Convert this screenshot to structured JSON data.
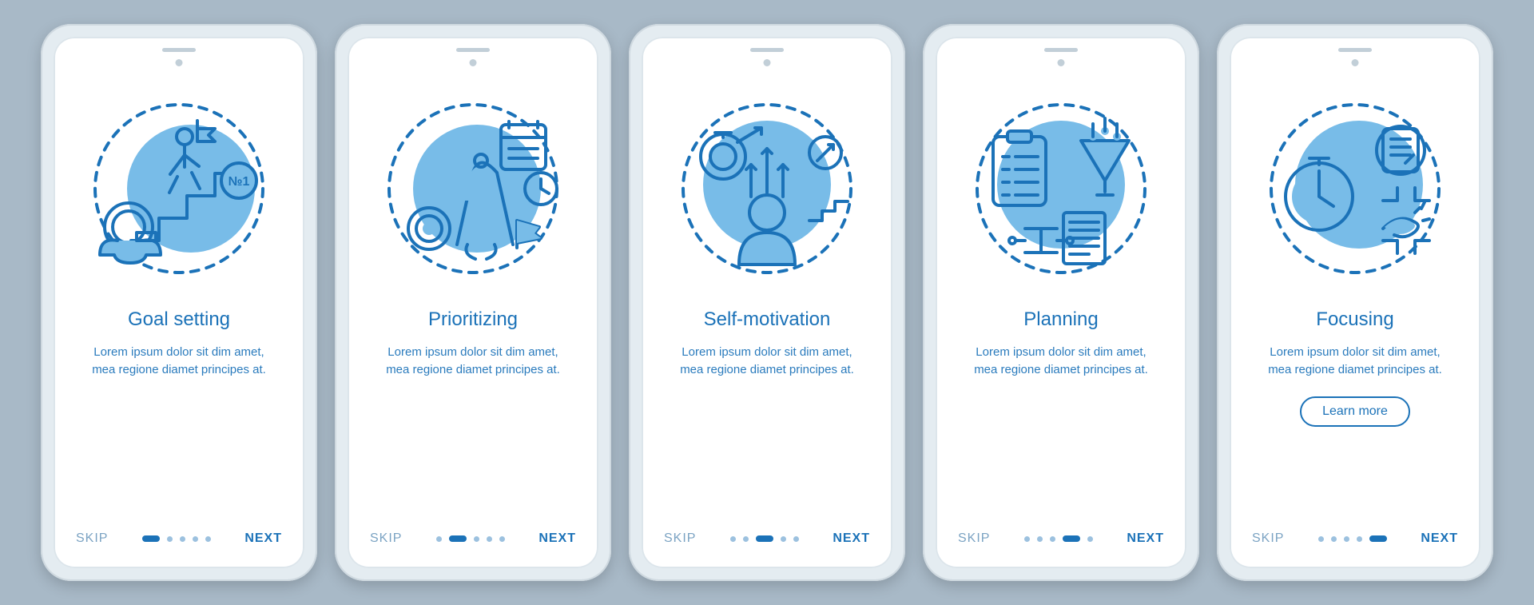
{
  "common": {
    "desc": "Lorem ipsum dolor sit dim amet, mea regione diamet principes at.",
    "skip": "SKIP",
    "next": "NEXT",
    "learn_more": "Learn more"
  },
  "colors": {
    "primary": "#1b72b8",
    "accent": "#78bce8",
    "muted": "#7ba3c3",
    "background": "#a8b9c7",
    "phone": "#e4ecf1"
  },
  "screens": [
    {
      "title": "Goal setting",
      "icon": "goal-setting-icon",
      "active_index": 0,
      "show_cta": false
    },
    {
      "title": "Prioritizing",
      "icon": "prioritizing-icon",
      "active_index": 1,
      "show_cta": false
    },
    {
      "title": "Self-motivation",
      "icon": "self-motivation-icon",
      "active_index": 2,
      "show_cta": false
    },
    {
      "title": "Planning",
      "icon": "planning-icon",
      "active_index": 3,
      "show_cta": false
    },
    {
      "title": "Focusing",
      "icon": "focusing-icon",
      "active_index": 4,
      "show_cta": true
    }
  ]
}
